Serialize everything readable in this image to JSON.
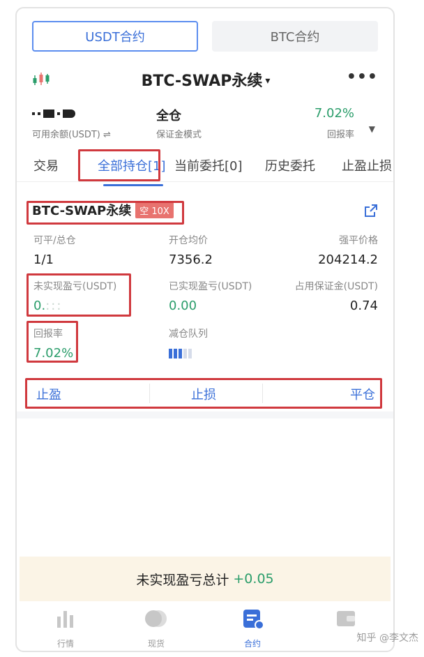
{
  "contract_tabs": {
    "usdt": "USDT合约",
    "btc": "BTC合约"
  },
  "header": {
    "title": "BTC-SWAP永续",
    "caret": "▾",
    "more": "•••"
  },
  "summary": {
    "balance_label": "可用余额(USDT) ⇌",
    "margin_mode_value": "全仓",
    "margin_mode_label": "保证金模式",
    "return_value": "7.02%",
    "return_label": "回报率",
    "caret": "▼"
  },
  "position_tabs": [
    "交易",
    "全部持仓[1]",
    "当前委托[0]",
    "历史委托",
    "止盈止损"
  ],
  "card": {
    "title": "BTC-SWAP永续",
    "tag": "空 10X",
    "available_total_label": "可平/总仓",
    "available_total_value": "1/1",
    "avg_open_label": "开仓均价",
    "avg_open_value": "7356.2",
    "liq_label": "强平价格",
    "liq_value": "204214.2",
    "unrealized_label": "未实现盈亏(USDT)",
    "unrealized_value": "0.",
    "realized_label": "已实现盈亏(USDT)",
    "realized_value": "0.00",
    "margin_used_label": "占用保证金(USDT)",
    "margin_used_value": "0.74",
    "return_label": "回报率",
    "return_value": "7.02%",
    "adl_label": "减仓队列",
    "adl_level": 3,
    "adl_max": 5
  },
  "actions": {
    "take_profit": "止盈",
    "stop_loss": "止损",
    "close": "平仓"
  },
  "total": {
    "label": "未实现盈亏总计",
    "value": "+0.05"
  },
  "nav": [
    {
      "label": "行情",
      "icon": "market-bars-icon"
    },
    {
      "label": "现货",
      "icon": "spot-coins-icon"
    },
    {
      "label": "合约",
      "icon": "contract-doc-icon"
    },
    {
      "label": "",
      "icon": "wallet-icon"
    }
  ],
  "watermark": "知乎 @李文杰",
  "colors": {
    "accent": "#3a6fd8",
    "positive": "#2a9d6a",
    "highlight_box": "#d0393e",
    "short_tag": "#e8736f",
    "total_bar": "#fbf4e6"
  }
}
